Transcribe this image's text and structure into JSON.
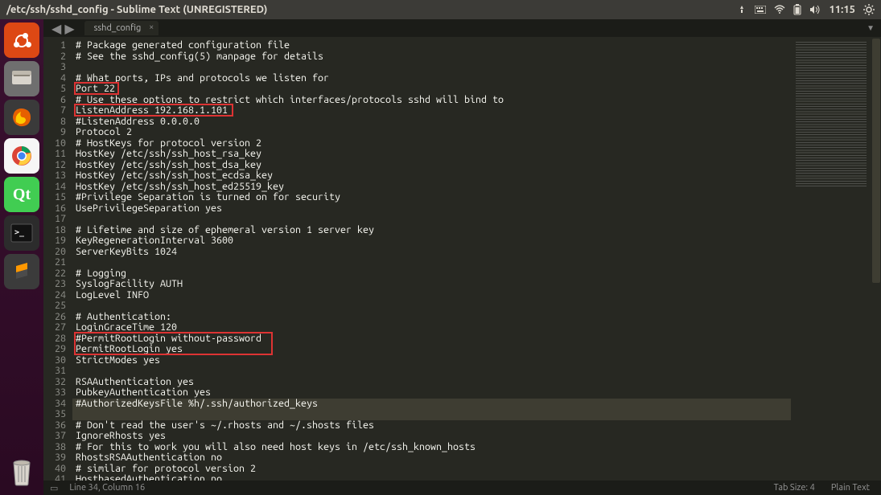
{
  "window": {
    "title": "/etc/ssh/sshd_config - Sublime Text (UNREGISTERED)"
  },
  "tray": {
    "time": "11:15"
  },
  "tabs": {
    "active": "sshd_config"
  },
  "code_lines": [
    "# Package generated configuration file",
    "# See the sshd_config(5) manpage for details",
    "",
    "# What ports, IPs and protocols we listen for",
    "Port 22",
    "# Use these options to restrict which interfaces/protocols sshd will bind to",
    "ListenAddress 192.168.1.101",
    "#ListenAddress 0.0.0.0",
    "Protocol 2",
    "# HostKeys for protocol version 2",
    "HostKey /etc/ssh/ssh_host_rsa_key",
    "HostKey /etc/ssh/ssh_host_dsa_key",
    "HostKey /etc/ssh/ssh_host_ecdsa_key",
    "HostKey /etc/ssh/ssh_host_ed25519_key",
    "#Privilege Separation is turned on for security",
    "UsePrivilegeSeparation yes",
    "",
    "# Lifetime and size of ephemeral version 1 server key",
    "KeyRegenerationInterval 3600",
    "ServerKeyBits 1024",
    "",
    "# Logging",
    "SyslogFacility AUTH",
    "LogLevel INFO",
    "",
    "# Authentication:",
    "LoginGraceTime 120",
    "#PermitRootLogin without-password",
    "PermitRootLogin yes",
    "StrictModes yes",
    "",
    "RSAAuthentication yes",
    "PubkeyAuthentication yes",
    "#AuthorizedKeysFile %h/.ssh/authorized_keys",
    "",
    "# Don't read the user's ~/.rhosts and ~/.shosts files",
    "IgnoreRhosts yes",
    "# For this to work you will also need host keys in /etc/ssh_known_hosts",
    "RhostsRSAAuthentication no",
    "# similar for protocol version 2",
    "HostbasedAuthentication no"
  ],
  "highlight_lines": [
    34,
    35
  ],
  "status": {
    "linecol": "Line 34, Column 16",
    "tabsize": "Tab Size: 4",
    "syntax": "Plain Text"
  },
  "launcher_apps": [
    {
      "name": "ubuntu-dash",
      "bg": "#dd4814"
    },
    {
      "name": "files",
      "bg": "#5f5f5f"
    },
    {
      "name": "firefox",
      "bg": "#3a3a3a"
    },
    {
      "name": "chrome",
      "bg": "#f2f2f2"
    },
    {
      "name": "qt-creator",
      "bg": "#4cbf4c"
    },
    {
      "name": "terminal",
      "bg": "#2c2c2c"
    },
    {
      "name": "sublime-text",
      "bg": "#3b3b3b"
    }
  ],
  "redboxes": [
    {
      "line_start": 5,
      "line_end": 5,
      "col_start": 0,
      "col_end": 7
    },
    {
      "line_start": 7,
      "line_end": 7,
      "col_start": 0,
      "col_end": 27
    },
    {
      "line_start": 28,
      "line_end": 29,
      "col_start": 0,
      "col_end": 34
    }
  ]
}
